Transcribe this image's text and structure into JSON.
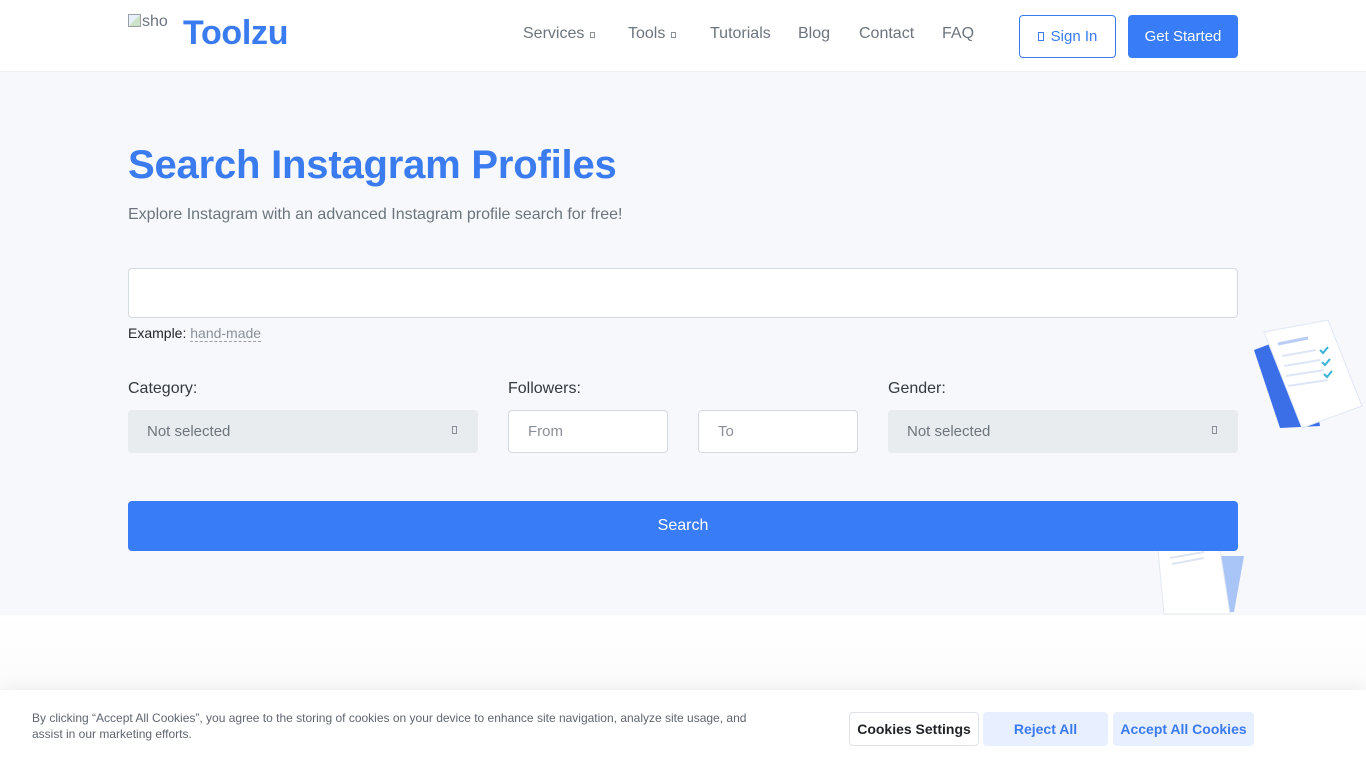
{
  "header": {
    "logo_alt": "sho",
    "brand": "Toolzu",
    "nav": [
      {
        "label": "Services",
        "has_dropdown": true
      },
      {
        "label": "Tools",
        "has_dropdown": true
      },
      {
        "label": "Tutorials",
        "has_dropdown": false
      },
      {
        "label": "Blog",
        "has_dropdown": false
      },
      {
        "label": "Contact",
        "has_dropdown": false
      },
      {
        "label": "FAQ",
        "has_dropdown": false
      }
    ],
    "sign_in": "Sign In",
    "get_started": "Get Started"
  },
  "hero": {
    "title": "Search Instagram Profiles",
    "subtitle": "Explore Instagram with an advanced Instagram profile search for free!",
    "search_value": "",
    "example_label": "Example:",
    "example_link": "hand-made"
  },
  "filters": {
    "category_label": "Category:",
    "category_value": "Not selected",
    "followers_label": "Followers:",
    "followers_from_placeholder": "From",
    "followers_to_placeholder": "To",
    "gender_label": "Gender:",
    "gender_value": "Not selected"
  },
  "search_button": "Search",
  "cookie": {
    "text": "By clicking “Accept All Cookies”, you agree to the storing of cookies on your device to enhance site navigation, analyze site usage, and assist in our marketing efforts.",
    "settings": "Cookies Settings",
    "reject": "Reject All",
    "accept": "Accept All Cookies"
  },
  "colors": {
    "accent": "#387cf7",
    "hero_bg": "#f6f8fb",
    "select_bg": "#e9ecef"
  }
}
